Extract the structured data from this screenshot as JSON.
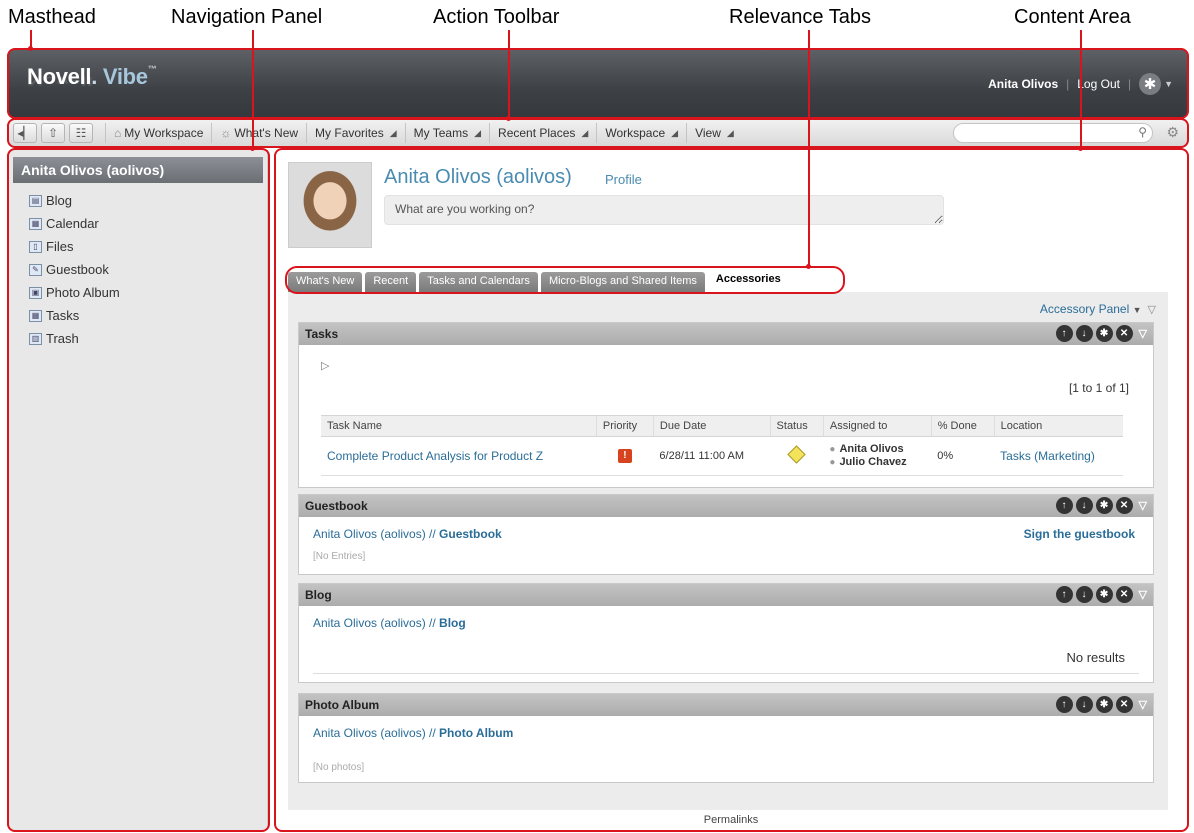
{
  "callouts": {
    "masthead": "Masthead",
    "navigation_panel": "Navigation Panel",
    "action_toolbar": "Action Toolbar",
    "relevance_tabs": "Relevance Tabs",
    "content_area": "Content Area"
  },
  "masthead": {
    "logo_novell": "Novell",
    "logo_dot": ".",
    "logo_vibe": " Vibe",
    "logo_tm": "™",
    "user_name": "Anita Olivos",
    "separator": "|",
    "logout": "Log Out",
    "gear_icon": "gear-icon"
  },
  "toolbar": {
    "icons": [
      "back-icon",
      "upload-icon",
      "tree-icon"
    ],
    "items": [
      {
        "label": "My Workspace",
        "icon": "⌂",
        "has_arrow": false
      },
      {
        "label": "What's New",
        "icon": "☼",
        "has_arrow": false
      },
      {
        "label": "My Favorites",
        "icon": "",
        "has_arrow": true
      },
      {
        "label": "My Teams",
        "icon": "",
        "has_arrow": true
      },
      {
        "label": "Recent Places",
        "icon": "",
        "has_arrow": true
      },
      {
        "label": "Workspace",
        "icon": "",
        "has_arrow": true
      },
      {
        "label": "View",
        "icon": "",
        "has_arrow": true
      }
    ],
    "search_placeholder": ""
  },
  "nav": {
    "title": "Anita Olivos (aolivos)",
    "items": [
      {
        "label": "Blog",
        "icon": "blog-icon"
      },
      {
        "label": "Calendar",
        "icon": "calendar-icon"
      },
      {
        "label": "Files",
        "icon": "files-icon"
      },
      {
        "label": "Guestbook",
        "icon": "guestbook-icon"
      },
      {
        "label": "Photo Album",
        "icon": "photo-album-icon"
      },
      {
        "label": "Tasks",
        "icon": "tasks-icon"
      },
      {
        "label": "Trash",
        "icon": "trash-icon"
      }
    ]
  },
  "profile": {
    "name": "Anita Olivos (aolivos)",
    "profile_link": "Profile",
    "status_placeholder": "What are you working on?"
  },
  "tabs": [
    "What's New",
    "Recent",
    "Tasks and Calendars",
    "Micro-Blogs and Shared Items",
    "Accessories"
  ],
  "active_tab": "Accessories",
  "accessory_panel": "Accessory Panel",
  "widgets": {
    "tasks": {
      "title": "Tasks",
      "pagination": "[1 to 1 of 1]",
      "columns": [
        "Task Name",
        "Priority",
        "Due Date",
        "Status",
        "Assigned to",
        "% Done",
        "Location"
      ],
      "rows": [
        {
          "task_name": "Complete Product Analysis for Product Z",
          "priority_icon": "high-priority-icon",
          "due_date": "6/28/11 11:00 AM",
          "status_icon": "in-progress-status-icon",
          "assigned": [
            "Anita Olivos",
            "Julio Chavez"
          ],
          "percent_done": "0%",
          "location": "Tasks (Marketing)"
        }
      ]
    },
    "guestbook": {
      "title": "Guestbook",
      "path_prefix": "Anita Olivos (aolivos) // ",
      "path_name": "Guestbook",
      "action": "Sign the guestbook",
      "empty": "[No Entries]"
    },
    "blog": {
      "title": "Blog",
      "path_prefix": "Anita Olivos (aolivos) // ",
      "path_name": "Blog",
      "empty": "No results"
    },
    "photo_album": {
      "title": "Photo Album",
      "path_prefix": "Anita Olivos (aolivos) // ",
      "path_name": "Photo Album",
      "empty": "[No photos]"
    }
  },
  "footer": {
    "permalinks": "Permalinks"
  },
  "colors": {
    "callout_red": "#d9141c",
    "link_blue": "#2a6d98",
    "profile_blue": "#4a8bb0",
    "masthead_dark": "#3d4145"
  }
}
